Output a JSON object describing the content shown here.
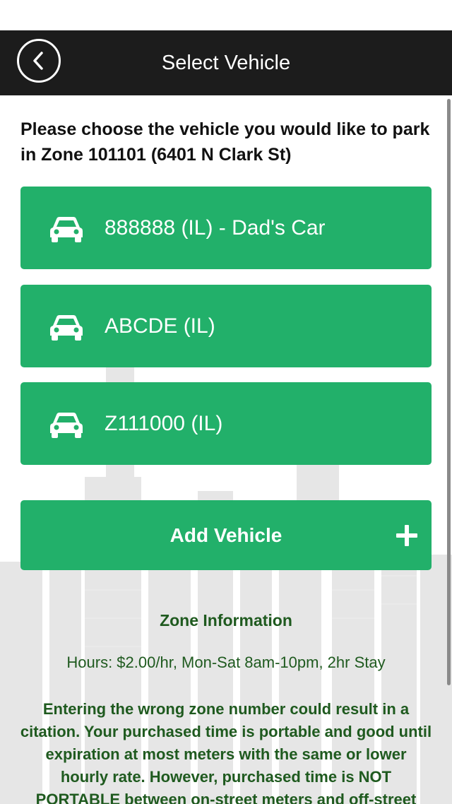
{
  "header": {
    "title": "Select Vehicle"
  },
  "prompt": "Please choose the vehicle you would like to park in Zone 101101 (6401 N Clark St)",
  "vehicles": [
    {
      "label": "888888 (IL) - Dad's Car",
      "icon": "car-icon"
    },
    {
      "label": "ABCDE (IL)",
      "icon": "car-icon"
    },
    {
      "label": "Z111000 (IL)",
      "icon": "car-icon"
    }
  ],
  "add_vehicle": {
    "label": "Add Vehicle",
    "icon": "plus-icon"
  },
  "zone_info": {
    "title": "Zone Information",
    "hours": "Hours: $2.00/hr, Mon-Sat 8am-10pm, 2hr Stay",
    "warning": "Entering the wrong zone number could result in a citation. Your purchased time is portable and good until expiration at most meters with the same or lower hourly rate. However, purchased time is NOT PORTABLE between on-street meters and off-street"
  },
  "colors": {
    "accent": "#22b06a",
    "header_bg": "#1c1c1c",
    "info_text": "#1f5a1f"
  }
}
